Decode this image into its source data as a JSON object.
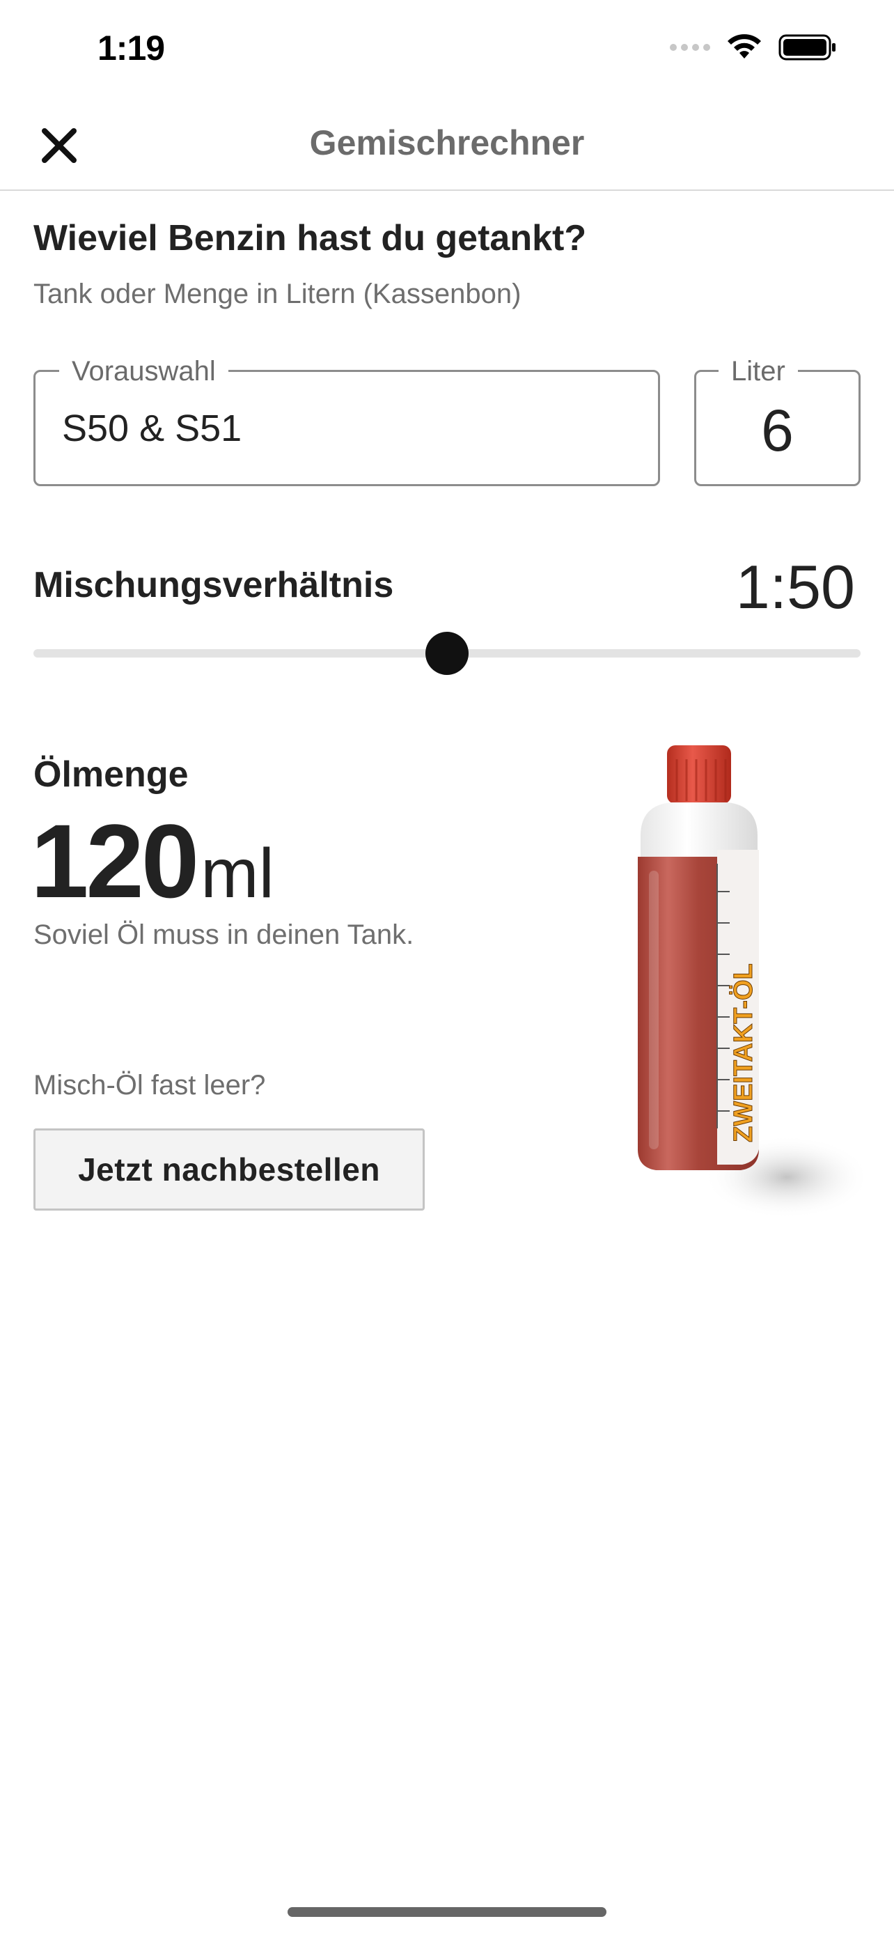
{
  "status_bar": {
    "time": "1:19",
    "icons": [
      "signal-icon",
      "wifi-icon",
      "battery-icon"
    ]
  },
  "nav": {
    "title": "Gemischrechner",
    "close_icon": "close-icon"
  },
  "question": {
    "title": "Wieviel Benzin hast du getankt?",
    "subtitle": "Tank oder Menge in Litern (Kassenbon)"
  },
  "preset_field": {
    "label": "Vorauswahl",
    "value": "S50 & S51"
  },
  "liter_field": {
    "label": "Liter",
    "value": "6"
  },
  "ratio": {
    "label": "Mischungsverhältnis",
    "value": "1:50",
    "slider_level": 0.5
  },
  "oil": {
    "label": "Ölmenge",
    "amount": "120",
    "unit": "ml",
    "description": "Soviel Öl muss in deinen Tank."
  },
  "reorder": {
    "hint": "Misch-Öl fast leer?",
    "button_label": "Jetzt nachbestellen"
  },
  "bottle": {
    "label": "ZWEITAKT-ÖL",
    "icon": "oil-bottle-image"
  },
  "colors": {
    "accent_thumb": "#111111",
    "bottle_cap": "#d8402c",
    "bottle_oil": "#a8453a",
    "bottle_label_text": "#f0a020"
  }
}
